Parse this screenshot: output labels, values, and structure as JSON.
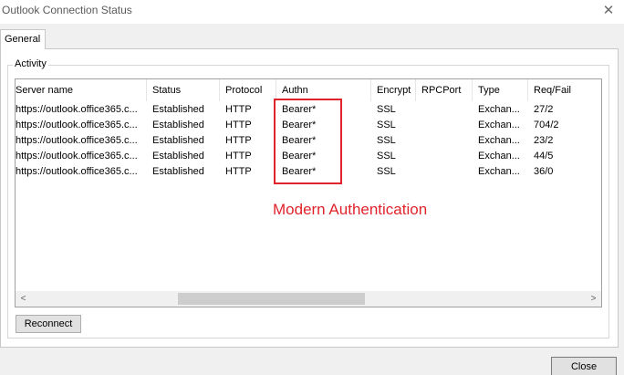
{
  "window": {
    "title": "Outlook Connection Status",
    "close_glyph": "✕"
  },
  "tabs": [
    {
      "label": "General",
      "active": true
    }
  ],
  "activity": {
    "group_label": "Activity",
    "columns": [
      "Server name",
      "Status",
      "Protocol",
      "Authn",
      "Encrypt",
      "RPCPort",
      "Type",
      "Req/Fail"
    ],
    "rows": [
      [
        "https://outlook.office365.c...",
        "Established",
        "HTTP",
        "Bearer*",
        "SSL",
        "",
        "Exchan...",
        "27/2"
      ],
      [
        "https://outlook.office365.c...",
        "Established",
        "HTTP",
        "Bearer*",
        "SSL",
        "",
        "Exchan...",
        "704/2"
      ],
      [
        "https://outlook.office365.c...",
        "Established",
        "HTTP",
        "Bearer*",
        "SSL",
        "",
        "Exchan...",
        "23/2"
      ],
      [
        "https://outlook.office365.c...",
        "Established",
        "HTTP",
        "Bearer*",
        "SSL",
        "",
        "Exchan...",
        "44/5"
      ],
      [
        "https://outlook.office365.c...",
        "Established",
        "HTTP",
        "Bearer*",
        "SSL",
        "",
        "Exchan...",
        "36/0"
      ]
    ],
    "scroll_left_glyph": "<",
    "scroll_right_glyph": ">"
  },
  "annotation": {
    "text": "Modern Authentication",
    "color": "#e0242b"
  },
  "buttons": {
    "reconnect": "Reconnect",
    "close": "Close"
  }
}
